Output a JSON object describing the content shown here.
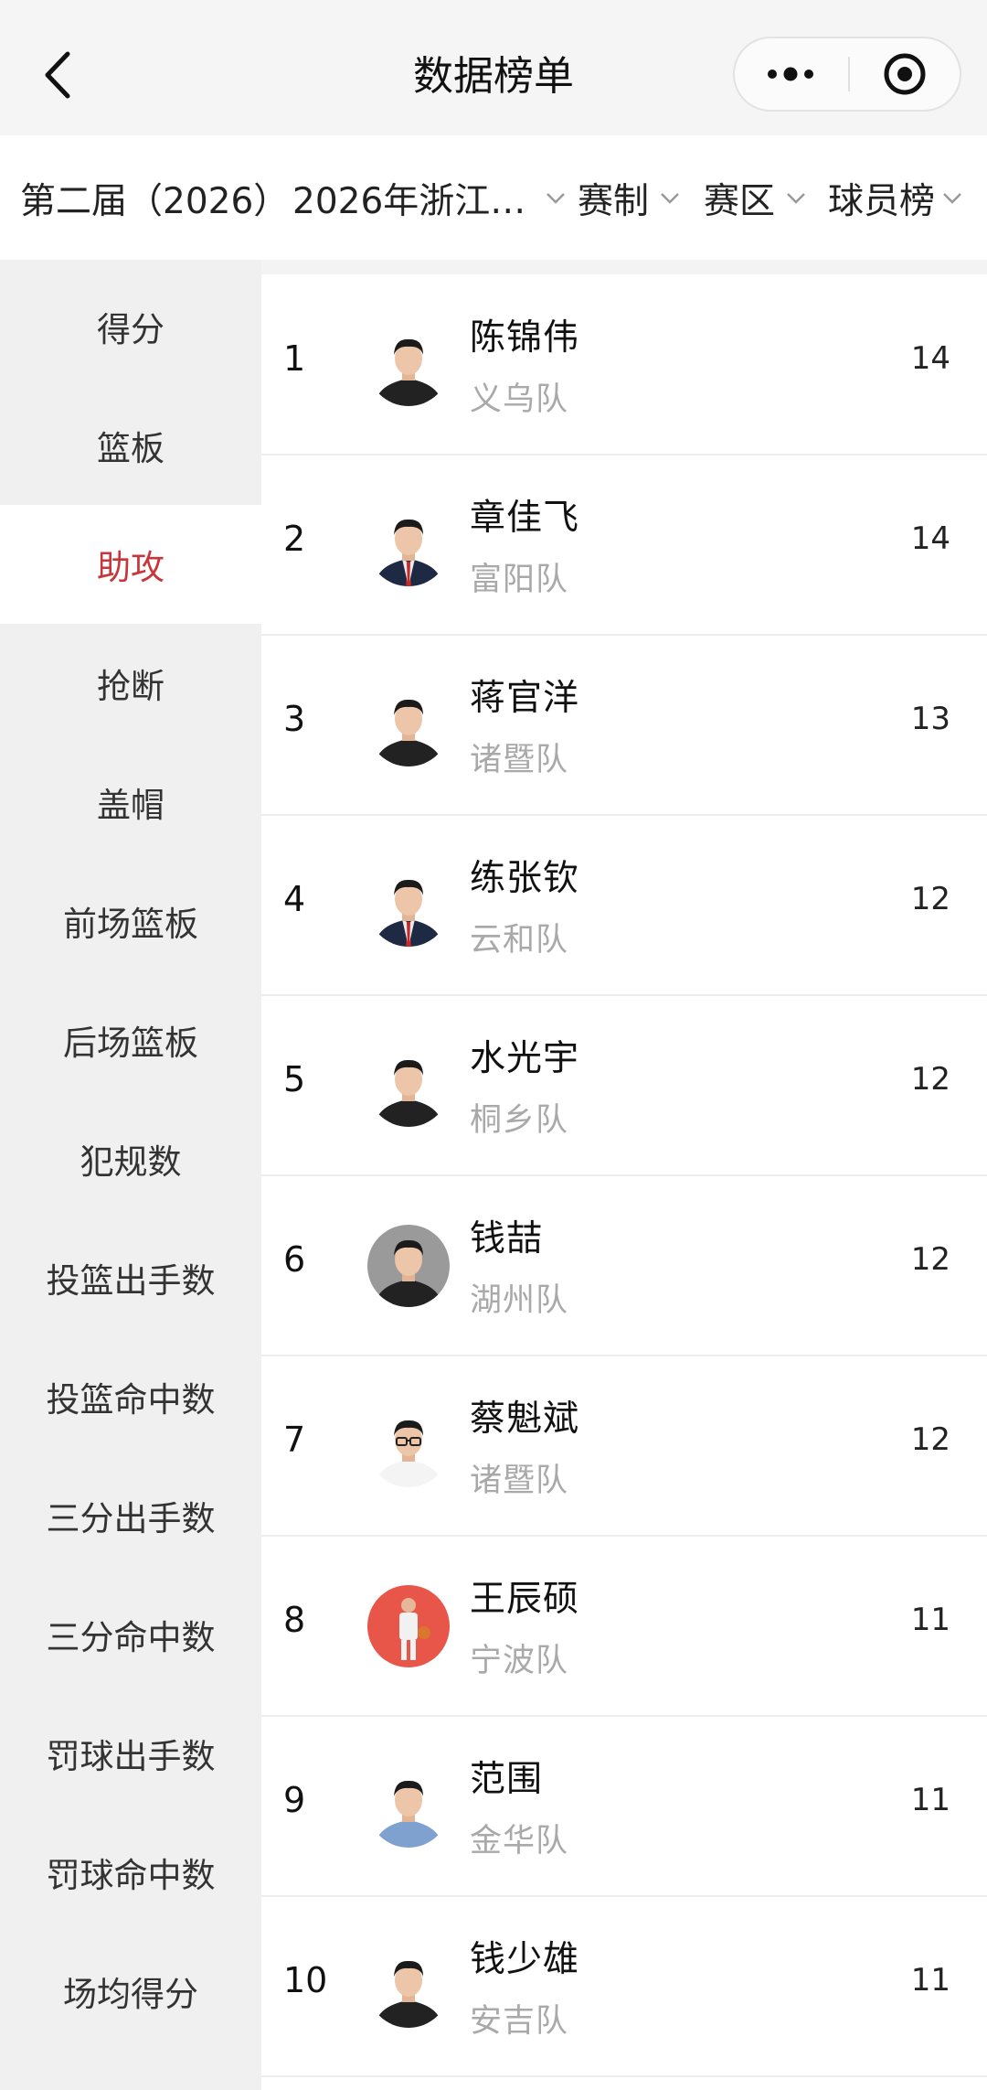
{
  "header": {
    "title": "数据榜单",
    "back_icon": "chevron-left-icon",
    "more_icon": "more-dots-icon",
    "target_icon": "target-circle-icon"
  },
  "filters": [
    {
      "label": "第二届（2026）",
      "has_chevron": false
    },
    {
      "label": "2026年浙江…",
      "has_chevron": true
    },
    {
      "label": "赛制",
      "has_chevron": true
    },
    {
      "label": "赛区",
      "has_chevron": true
    },
    {
      "label": "球员榜",
      "has_chevron": true
    }
  ],
  "sidebar": {
    "active_index": 2,
    "active_color": "#c7363a",
    "items": [
      {
        "label": "得分"
      },
      {
        "label": "篮板"
      },
      {
        "label": "助攻"
      },
      {
        "label": "抢断"
      },
      {
        "label": "盖帽"
      },
      {
        "label": "前场篮板"
      },
      {
        "label": "后场篮板"
      },
      {
        "label": "犯规数"
      },
      {
        "label": "投篮出手数"
      },
      {
        "label": "投篮命中数"
      },
      {
        "label": "三分出手数"
      },
      {
        "label": "三分命中数"
      },
      {
        "label": "罚球出手数"
      },
      {
        "label": "罚球命中数"
      },
      {
        "label": "场均得分"
      }
    ]
  },
  "rankings": [
    {
      "rank": "1",
      "name": "陈锦伟",
      "team": "义乌队",
      "value": "14",
      "avatar_style": "white-bg"
    },
    {
      "rank": "2",
      "name": "章佳飞",
      "team": "富阳队",
      "value": "14",
      "avatar_style": "white-bg-suit-red-tie"
    },
    {
      "rank": "3",
      "name": "蒋官洋",
      "team": "诸暨队",
      "value": "13",
      "avatar_style": "white-bg"
    },
    {
      "rank": "4",
      "name": "练张钦",
      "team": "云和队",
      "value": "12",
      "avatar_style": "white-bg-suit-red-tie"
    },
    {
      "rank": "5",
      "name": "水光宇",
      "team": "桐乡队",
      "value": "12",
      "avatar_style": "white-bg"
    },
    {
      "rank": "6",
      "name": "钱喆",
      "team": "湖州队",
      "value": "12",
      "avatar_style": "gray-bg"
    },
    {
      "rank": "7",
      "name": "蔡魁斌",
      "team": "诸暨队",
      "value": "12",
      "avatar_style": "white-bg-glasses"
    },
    {
      "rank": "8",
      "name": "王辰硕",
      "team": "宁波队",
      "value": "11",
      "avatar_style": "red-bg-fullbody"
    },
    {
      "rank": "9",
      "name": "范围",
      "team": "金华队",
      "value": "11",
      "avatar_style": "white-bg-blue-shirt"
    },
    {
      "rank": "10",
      "name": "钱少雄",
      "team": "安吉队",
      "value": "11",
      "avatar_style": "white-bg"
    }
  ]
}
